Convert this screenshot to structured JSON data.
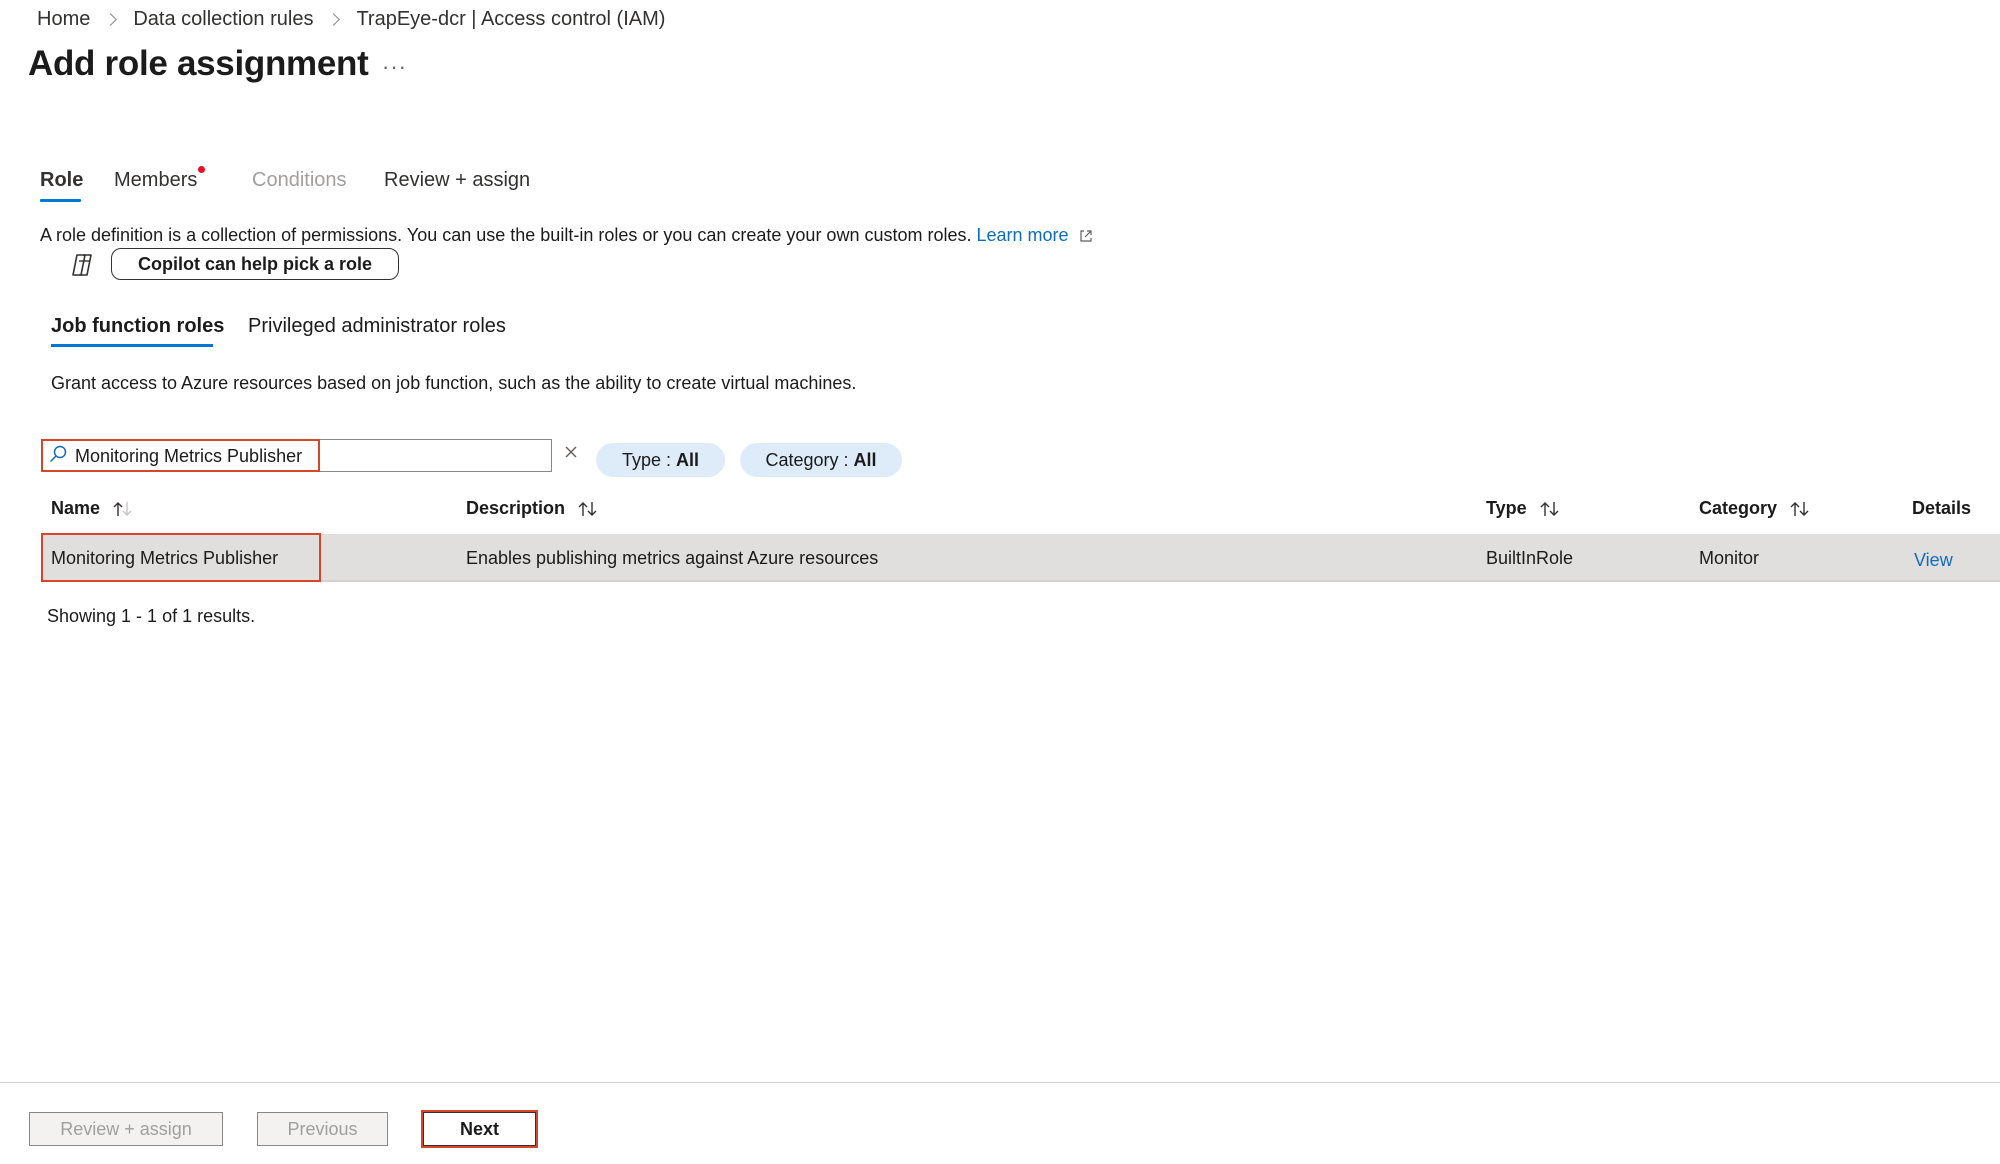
{
  "breadcrumb": {
    "home": "Home",
    "items": [
      "Data collection rules",
      "TrapEye-dcr | Access control (IAM)"
    ]
  },
  "page": {
    "title": "Add role assignment",
    "more_label": "···"
  },
  "wizard_tabs": [
    {
      "label": "Role",
      "state": "active"
    },
    {
      "label": "Members",
      "state": "required"
    },
    {
      "label": "Conditions",
      "state": "disabled"
    },
    {
      "label": "Review + assign",
      "state": "normal"
    }
  ],
  "intro": {
    "text": "A role definition is a collection of permissions. You can use the built-in roles or you can create your own custom roles.",
    "learn_more": "Learn more"
  },
  "copilot": {
    "button_label": "Copilot can help pick a role",
    "icon": "copilot-icon"
  },
  "role_tabs": [
    {
      "label": "Job function roles",
      "active": true
    },
    {
      "label": "Privileged administrator roles",
      "active": false
    }
  ],
  "role_tab_description": "Grant access to Azure resources based on job function, such as the ability to create virtual machines.",
  "search": {
    "value": "Monitoring Metrics Publisher"
  },
  "filters": [
    {
      "label": "Type :",
      "value": "All"
    },
    {
      "label": "Category :",
      "value": "All"
    }
  ],
  "table": {
    "headers": {
      "name": "Name",
      "description": "Description",
      "type": "Type",
      "category": "Category",
      "details": "Details"
    },
    "rows": [
      {
        "name": "Monitoring Metrics Publisher",
        "description": "Enables publishing metrics against Azure resources",
        "type": "BuiltInRole",
        "category": "Monitor",
        "details": "View"
      }
    ]
  },
  "results_text": "Showing 1 - 1 of 1 results.",
  "footer": {
    "review_assign": "Review + assign",
    "previous": "Previous",
    "next": "Next"
  },
  "colors": {
    "accent": "#0078d4",
    "link": "#0f6cbd",
    "highlight": "#d9452b",
    "required_dot": "#e81123",
    "pill_bg": "#deecf9",
    "selected_row": "#e1dfdd"
  }
}
